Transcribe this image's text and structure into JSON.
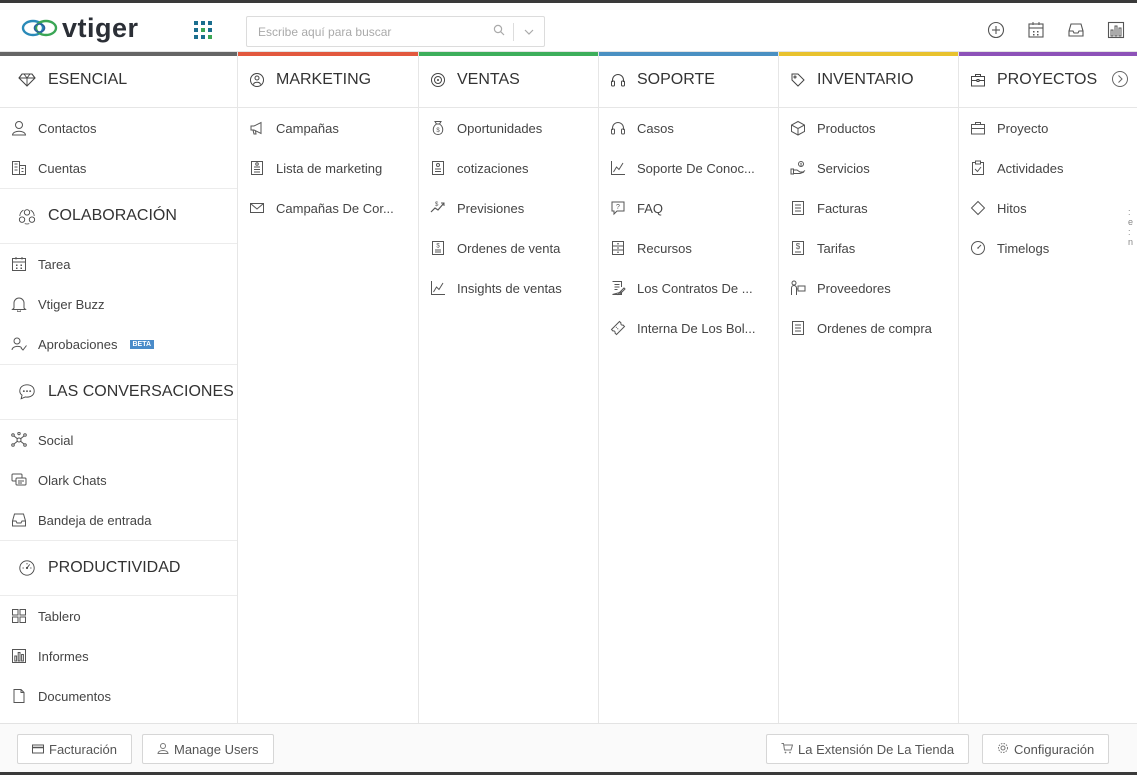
{
  "header": {
    "logo_text": "vtiger",
    "search_placeholder": "Escribe aquí para buscar"
  },
  "columns": {
    "essential": {
      "title": "ESENCIAL",
      "items": [
        {
          "label": "Contactos"
        },
        {
          "label": "Cuentas"
        }
      ],
      "sections": [
        {
          "title": "COLABORACIÓN",
          "items": [
            {
              "label": "Tarea"
            },
            {
              "label": "Vtiger Buzz"
            },
            {
              "label": "Aprobaciones"
            }
          ]
        },
        {
          "title": "LAS CONVERSACIONES",
          "items": [
            {
              "label": "Social"
            },
            {
              "label": "Olark Chats"
            },
            {
              "label": "Bandeja de entrada"
            }
          ]
        },
        {
          "title": "PRODUCTIVIDAD",
          "items": [
            {
              "label": "Tablero"
            },
            {
              "label": "Informes"
            },
            {
              "label": "Documentos"
            }
          ]
        }
      ],
      "beta_badge": "BETA"
    },
    "marketing": {
      "title": "MARKETING",
      "color": "#e2583e",
      "items": [
        {
          "label": "Campañas"
        },
        {
          "label": "Lista de marketing"
        },
        {
          "label": "Campañas De Cor..."
        }
      ]
    },
    "sales": {
      "title": "VENTAS",
      "color": "#3dae5b",
      "items": [
        {
          "label": "Oportunidades"
        },
        {
          "label": "cotizaciones"
        },
        {
          "label": "Previsiones"
        },
        {
          "label": "Ordenes de venta"
        },
        {
          "label": "Insights de ventas"
        }
      ]
    },
    "support": {
      "title": "SOPORTE",
      "color": "#4a90c2",
      "items": [
        {
          "label": "Casos"
        },
        {
          "label": "Soporte De Conoc..."
        },
        {
          "label": "FAQ"
        },
        {
          "label": "Recursos"
        },
        {
          "label": "Los Contratos De ..."
        },
        {
          "label": "Interna De Los Bol..."
        }
      ]
    },
    "inventory": {
      "title": "INVENTARIO",
      "color": "#e8c22e",
      "items": [
        {
          "label": "Productos"
        },
        {
          "label": "Servicios"
        },
        {
          "label": "Facturas"
        },
        {
          "label": "Tarifas"
        },
        {
          "label": "Proveedores"
        },
        {
          "label": "Ordenes de compra"
        }
      ]
    },
    "projects": {
      "title": "PROYECTOS",
      "color": "#8d52b8",
      "items": [
        {
          "label": "Proyecto"
        },
        {
          "label": "Actividades"
        },
        {
          "label": "Hitos"
        },
        {
          "label": "Timelogs"
        }
      ]
    }
  },
  "footer": {
    "billing": "Facturación",
    "manage_users": "Manage Users",
    "store": "La Extensión De La Tienda",
    "settings": "Configuración"
  },
  "accent_colors": {
    "top_bar": "#3a3a3a",
    "first_column_bar": "#666666"
  }
}
